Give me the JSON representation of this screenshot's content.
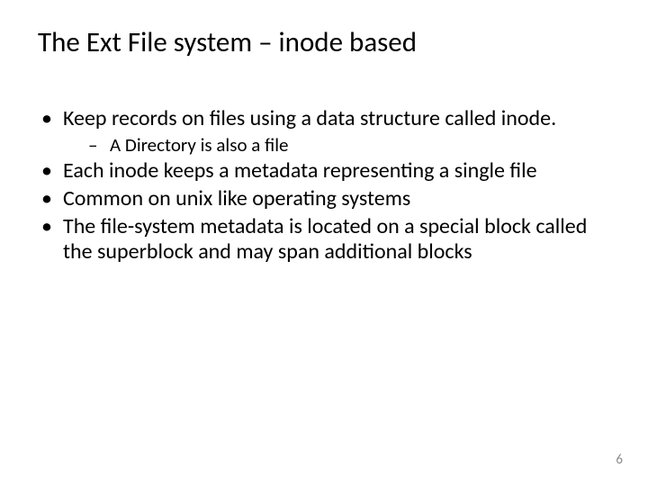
{
  "slide": {
    "title": "The Ext File system – inode based",
    "bullets": [
      {
        "text": "Keep records on files using a data structure called inode.",
        "sub": [
          {
            "text": "A Directory is also a file"
          }
        ]
      },
      {
        "text": "Each inode keeps a metadata representing a single file"
      },
      {
        "text": "Common on unix like operating systems"
      },
      {
        "text": "The file-system metadata is located on a special block called the superblock and may span additional blocks"
      }
    ],
    "page_number": "6"
  }
}
